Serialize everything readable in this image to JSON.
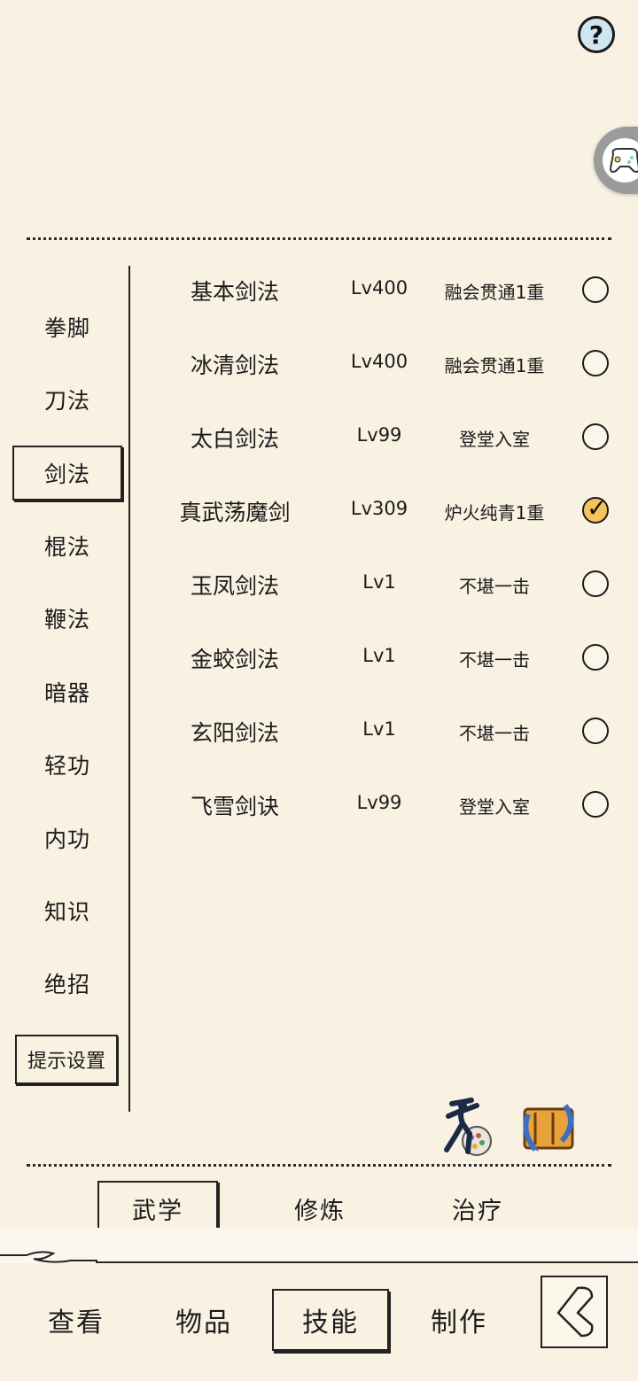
{
  "header": {
    "help_icon": "question-mark-icon",
    "help_label": "?"
  },
  "floating": {
    "icon": "gamepad-icon"
  },
  "sidebar": {
    "categories": [
      {
        "label": "拳脚",
        "active": false
      },
      {
        "label": "刀法",
        "active": false
      },
      {
        "label": "剑法",
        "active": true
      },
      {
        "label": "棍法",
        "active": false
      },
      {
        "label": "鞭法",
        "active": false
      },
      {
        "label": "暗器",
        "active": false
      },
      {
        "label": "轻功",
        "active": false
      },
      {
        "label": "内功",
        "active": false
      },
      {
        "label": "知识",
        "active": false
      },
      {
        "label": "绝招",
        "active": false
      }
    ],
    "hint_settings_label": "提示设置"
  },
  "skills": [
    {
      "name": "基本剑法",
      "level": "Lv400",
      "status": "融会贯通1重",
      "selected": false
    },
    {
      "name": "冰清剑法",
      "level": "Lv400",
      "status": "融会贯通1重",
      "selected": false
    },
    {
      "name": "太白剑法",
      "level": "Lv99",
      "status": "登堂入室",
      "selected": false
    },
    {
      "name": "真武荡魔剑",
      "level": "Lv309",
      "status": "炉火纯青1重",
      "selected": true
    },
    {
      "name": "玉凤剑法",
      "level": "Lv1",
      "status": "不堪一击",
      "selected": false
    },
    {
      "name": "金蛟剑法",
      "level": "Lv1",
      "status": "不堪一击",
      "selected": false
    },
    {
      "name": "玄阳剑法",
      "level": "Lv1",
      "status": "不堪一击",
      "selected": false
    },
    {
      "name": "飞雪剑诀",
      "level": "Lv99",
      "status": "登堂入室",
      "selected": false
    }
  ],
  "tools": {
    "left_icon": "martial-fighter-icon",
    "right_icon": "scroll-swap-icon"
  },
  "subtabs": [
    {
      "label": "武学",
      "active": true
    },
    {
      "label": "修炼",
      "active": false
    },
    {
      "label": "治疗",
      "active": false
    }
  ],
  "nav": [
    {
      "label": "查看",
      "active": false
    },
    {
      "label": "物品",
      "active": false
    },
    {
      "label": "技能",
      "active": true
    },
    {
      "label": "制作",
      "active": false
    }
  ],
  "back": {
    "icon": "back-arrow-icon"
  },
  "colors": {
    "background": "#f9f2e3",
    "ink": "#1b1b1b",
    "check_fill": "#f4c45a",
    "help_fill": "#cfe6ef"
  }
}
